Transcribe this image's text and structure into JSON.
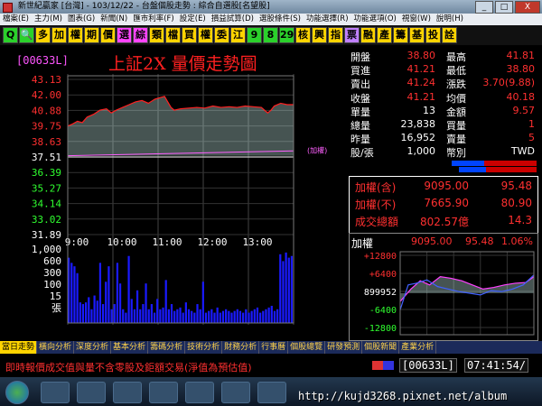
{
  "window": {
    "title": "新世紀贏家 [台灣] - 103/12/22 - 台盤個股走勢 : 綜合自選股[名望股]",
    "buttons": [
      "_",
      "□",
      "X"
    ]
  },
  "menubar": [
    "檔案(E)",
    "主力(M)",
    "圖表(G)",
    "新聞(N)",
    "匯市利率(F)",
    "設定(E)",
    "損益試算(D)",
    "選股條件(S)",
    "功能選擇(R)",
    "功能選項(O)",
    "視窗(W)",
    "說明(H)"
  ],
  "toolbar": [
    {
      "t": "Q",
      "bg": "#2bd12b"
    },
    {
      "t": "🔍",
      "bg": "#2bd12b"
    },
    {
      "t": "多",
      "bg": "#ffd400"
    },
    {
      "t": "加",
      "bg": "#ffd400"
    },
    {
      "t": "權",
      "bg": "#ffd400"
    },
    {
      "t": "期",
      "bg": "#ffd400"
    },
    {
      "t": "價",
      "bg": "#ffd400"
    },
    {
      "t": "選",
      "bg": "#ff44ff"
    },
    {
      "t": "綜",
      "bg": "#ff44ff"
    },
    {
      "t": "類",
      "bg": "#ffd400"
    },
    {
      "t": "檔",
      "bg": "#ffd400"
    },
    {
      "t": "買",
      "bg": "#ffd400"
    },
    {
      "t": "權",
      "bg": "#ffd400"
    },
    {
      "t": "委",
      "bg": "#ffd400"
    },
    {
      "t": "江",
      "bg": "#ffd400"
    },
    {
      "t": "9",
      "bg": "#2bd12b"
    },
    {
      "t": "8",
      "bg": "#2bd12b"
    },
    {
      "t": "29",
      "bg": "#2bd12b"
    },
    {
      "t": "核",
      "bg": "#ffd400"
    },
    {
      "t": "興",
      "bg": "#ffd400"
    },
    {
      "t": "指",
      "bg": "#ffd400"
    },
    {
      "t": "票",
      "bg": "#c080ff"
    },
    {
      "t": "融",
      "bg": "#ffd400"
    },
    {
      "t": "產",
      "bg": "#ffd400"
    },
    {
      "t": "籌",
      "bg": "#ffd400"
    },
    {
      "t": "基",
      "bg": "#ffd400"
    },
    {
      "t": "投",
      "bg": "#ffd400"
    },
    {
      "t": "詮",
      "bg": "#ffd400"
    }
  ],
  "left": {
    "code": "[00633L]",
    "title": "上証2X  量價走勢圖",
    "avg_note": "(加權)"
  },
  "chart_data": [
    {
      "type": "line",
      "title": "上証2X  量價走勢圖",
      "y_ticks": [
        "43.13",
        "42.00",
        "40.88",
        "39.75",
        "38.63",
        "37.51",
        "36.39",
        "35.27",
        "34.14",
        "33.02",
        "31.89"
      ],
      "y_tick_colors": [
        "#ff3030",
        "#ff3030",
        "#ff3030",
        "#ff3030",
        "#ff3030",
        "#ffffff",
        "#30ff30",
        "#30ff30",
        "#30ff30",
        "#30ff30",
        "#ffffff"
      ],
      "x_ticks": [
        "9:00",
        "10:00",
        "11:00",
        "12:00",
        "13:00"
      ],
      "ylim": [
        31.89,
        43.13
      ],
      "price": [
        [
          0,
          39.75
        ],
        [
          3,
          39.9
        ],
        [
          6,
          40.1
        ],
        [
          9,
          40.0
        ],
        [
          12,
          40.4
        ],
        [
          16,
          40.6
        ],
        [
          20,
          40.9
        ],
        [
          24,
          41.0
        ],
        [
          27,
          40.7
        ],
        [
          30,
          40.9
        ],
        [
          34,
          41.1
        ],
        [
          38,
          41.3
        ],
        [
          42,
          41.5
        ],
        [
          46,
          41.6
        ],
        [
          50,
          41.4
        ],
        [
          54,
          41.7
        ],
        [
          57,
          41.8
        ],
        [
          60,
          41.9
        ],
        [
          62,
          41.5
        ],
        [
          64,
          41.1
        ],
        [
          66,
          40.9
        ],
        [
          70,
          41.0
        ],
        [
          75,
          41.05
        ],
        [
          80,
          41.1
        ],
        [
          85,
          41.05
        ],
        [
          90,
          41.2
        ],
        [
          95,
          41.1
        ],
        [
          100,
          41.15
        ],
        [
          105,
          41.1
        ],
        [
          110,
          41.2
        ],
        [
          115,
          41.15
        ],
        [
          120,
          41.1
        ],
        [
          124,
          40.7
        ],
        [
          126,
          40.9
        ],
        [
          128,
          41.2
        ],
        [
          132,
          41.4
        ],
        [
          136,
          41.3
        ],
        [
          140,
          41.3
        ]
      ],
      "avg_price": [
        [
          0,
          37.6
        ],
        [
          140,
          37.95
        ]
      ],
      "grid": true
    },
    {
      "type": "bar",
      "title": "volume",
      "y_ticks": [
        "1,000",
        "600",
        "300",
        "100",
        "15",
        "張"
      ],
      "ylim": [
        0,
        1000
      ],
      "volumes": [
        190,
        175,
        165,
        145,
        60,
        55,
        60,
        75,
        40,
        80,
        65,
        175,
        55,
        120,
        165,
        40,
        55,
        175,
        115,
        40,
        30,
        195,
        70,
        40,
        95,
        40,
        55,
        115,
        40,
        55,
        30,
        70,
        40,
        45,
        125,
        40,
        55,
        35,
        40,
        45,
        30,
        60,
        40,
        35,
        30,
        55,
        40,
        120,
        30,
        35,
        40,
        30,
        45,
        30,
        35,
        40,
        35,
        30,
        35,
        40,
        35,
        30,
        40,
        30,
        35,
        40,
        45,
        30,
        35,
        40,
        45,
        50,
        35,
        40,
        200,
        180,
        205,
        190,
        195
      ]
    },
    {
      "type": "line",
      "title": "加權",
      "y_ticks": [
        "+12800",
        "+6400",
        "899952",
        "-6400",
        "-12800"
      ],
      "series": [
        {
          "name": "index",
          "color": "#ff40ff",
          "values": [
            [
              0,
              0.4
            ],
            [
              8,
              0.55
            ],
            [
              15,
              0.65
            ],
            [
              22,
              0.6
            ],
            [
              30,
              0.7
            ],
            [
              38,
              0.68
            ],
            [
              46,
              0.65
            ],
            [
              54,
              0.6
            ],
            [
              62,
              0.55
            ],
            [
              70,
              0.57
            ],
            [
              78,
              0.6
            ],
            [
              86,
              0.62
            ],
            [
              94,
              0.63
            ],
            [
              100,
              0.7
            ]
          ]
        },
        {
          "name": "buy_sell",
          "color": "#4060ff",
          "values": [
            [
              0,
              0.3
            ],
            [
              6,
              0.6
            ],
            [
              12,
              0.62
            ],
            [
              20,
              0.66
            ],
            [
              28,
              0.58
            ],
            [
              36,
              0.55
            ],
            [
              44,
              0.52
            ],
            [
              52,
              0.5
            ],
            [
              60,
              0.48
            ],
            [
              68,
              0.53
            ],
            [
              76,
              0.52
            ],
            [
              84,
              0.55
            ],
            [
              92,
              0.6
            ],
            [
              100,
              0.72
            ]
          ]
        }
      ]
    }
  ],
  "quote": {
    "rows": [
      {
        "l1": "開盤",
        "v1": "38.80",
        "c1": "#ff3030",
        "l2": "最高",
        "v2": "41.81",
        "c2": "#ff3030"
      },
      {
        "l1": "買進",
        "v1": "41.21",
        "c1": "#ff3030",
        "l2": "最低",
        "v2": "38.80",
        "c2": "#ff3030"
      },
      {
        "l1": "賣出",
        "v1": "41.24",
        "c1": "#ff3030",
        "l2": "漲跌",
        "v2": "3.70(9.88)",
        "c2": "#ff3030"
      },
      {
        "l1": "收盤",
        "v1": "41.21",
        "c1": "#ff3030",
        "l2": "均價",
        "v2": "40.18",
        "c2": "#ff3030"
      },
      {
        "l1": "單量",
        "v1": "13",
        "c1": "#ffffff",
        "l2": "金額",
        "v2": "9.57",
        "c2": "#ff3030"
      },
      {
        "l1": "總量",
        "v1": "23,838",
        "c1": "#ffffff",
        "l2": "買量",
        "v2": "1",
        "c2": "#ff3030"
      },
      {
        "l1": "昨量",
        "v1": "16,952",
        "c1": "#ffffff",
        "l2": "賣量",
        "v2": "5",
        "c2": "#ff3030"
      },
      {
        "l1": "股/張",
        "v1": "1,000",
        "c1": "#ffffff",
        "l2": "幣別",
        "v2": "TWD",
        "c2": "#ffffff"
      }
    ],
    "box": [
      {
        "l": "加權(含)",
        "v": "9095.00",
        "v2": "95.48"
      },
      {
        "l": "加權(不)",
        "v": "7665.90",
        "v2": "80.90"
      },
      {
        "l": "成交總額",
        "v": "802.57億",
        "v2": "14.3"
      }
    ]
  },
  "mini": {
    "label": "加權",
    "value": "9095.00",
    "change": "95.48",
    "pct": "1.06%"
  },
  "tabs": [
    "當日走勢",
    "橫向分析",
    "深度分析",
    "基本分析",
    "籌碼分析",
    "技術分析",
    "財務分析",
    "行事曆",
    "個股總覽",
    "研發預測",
    "個股新聞",
    "產業分析"
  ],
  "status": {
    "message": "即時報價成交值與量不含零股及鉅額交易(淨值為預估值)",
    "code": "[00633L]",
    "time": "07:41:54/"
  },
  "watermark": "http://kujd3268.pixnet.net/album"
}
